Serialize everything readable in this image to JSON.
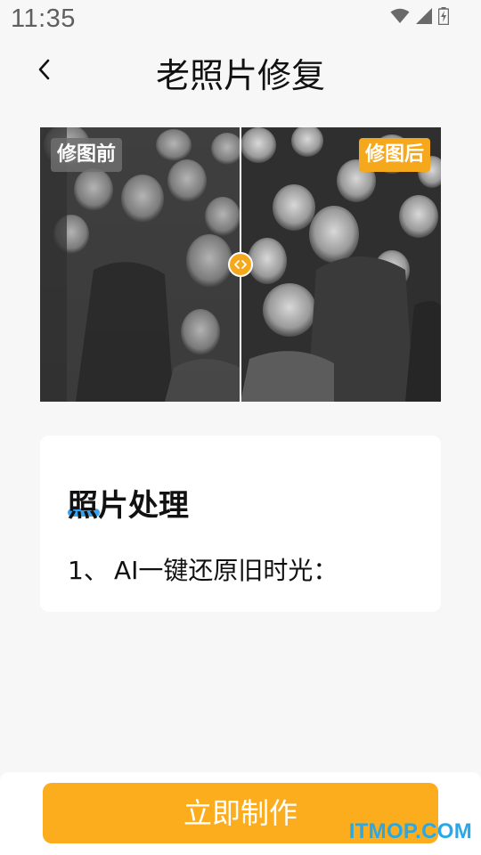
{
  "status_bar": {
    "time": "11:35"
  },
  "header": {
    "title": "老照片修复"
  },
  "compare": {
    "before_label": "修图前",
    "after_label": "修图后",
    "colors": {
      "after_tag": "#f5a81c",
      "before_tag": "#6e6e6e"
    }
  },
  "card": {
    "title": "照片处理",
    "items": [
      {
        "number": "1、",
        "text": "AI一键还原旧时光："
      }
    ]
  },
  "action": {
    "button_label": "立即制作",
    "color": "#fcad1d"
  },
  "watermark": "ITMOP.COM"
}
